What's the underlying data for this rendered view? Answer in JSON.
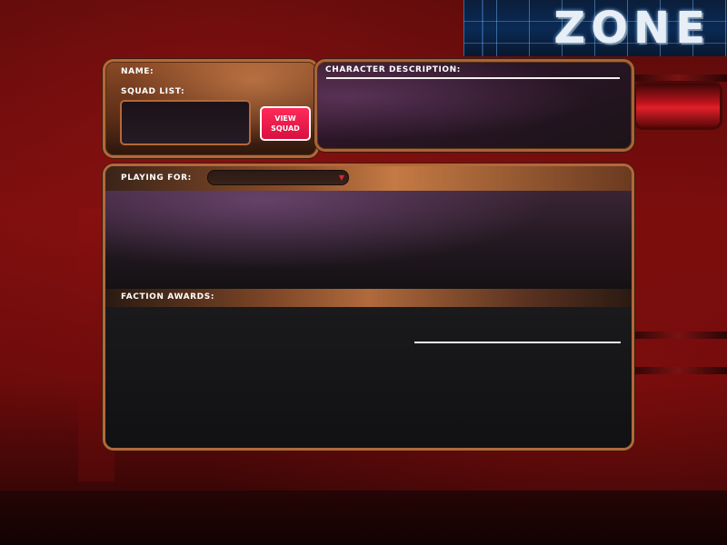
{
  "logo": {
    "text": "ZONE"
  },
  "profile": {
    "name_label": "NAME:",
    "squad_list_label": "SQUAD LIST:",
    "view_squad_button": {
      "line1": "VIEW",
      "line2": "SQUAD"
    }
  },
  "description": {
    "label": "CHARACTER DESCRIPTION:"
  },
  "playing": {
    "label": "PLAYING FOR:",
    "selected": ""
  },
  "awards": {
    "label": "FACTION AWARDS:"
  },
  "colors": {
    "panel_border": "#b4683a",
    "button_fill": "#e8184a",
    "dropdown_arrow": "#d8283a",
    "background_red": "#7a0d0d"
  },
  "icons": {
    "dropdown": "chevron-down-icon"
  }
}
